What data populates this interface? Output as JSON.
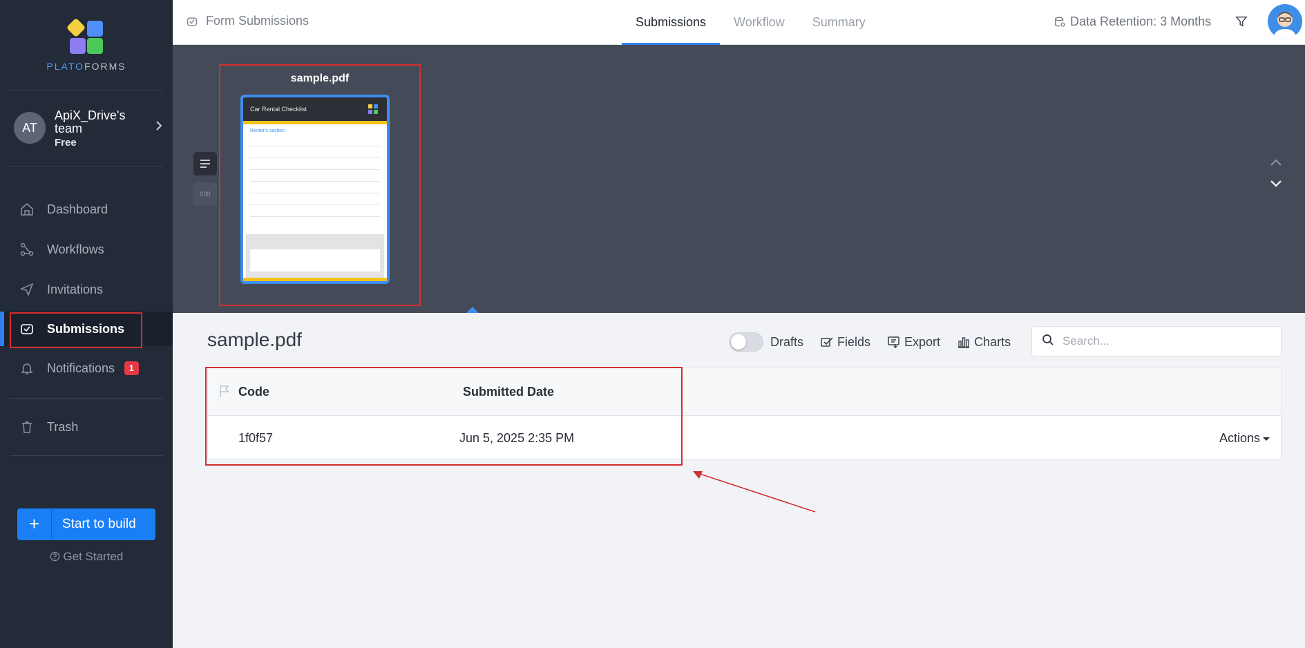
{
  "sidebar": {
    "logo": {
      "prefix": "PLATO",
      "suffix": "FORMS"
    },
    "team": {
      "initials": "AT",
      "name": "ApiX_Drive's team",
      "plan": "Free"
    },
    "nav": [
      {
        "label": "Dashboard",
        "icon": "home-icon"
      },
      {
        "label": "Workflows",
        "icon": "workflow-icon"
      },
      {
        "label": "Invitations",
        "icon": "send-icon"
      },
      {
        "label": "Submissions",
        "icon": "inbox-icon",
        "active": true
      },
      {
        "label": "Notifications",
        "icon": "bell-icon",
        "badge": "1"
      },
      {
        "label": "Trash",
        "icon": "trash-icon"
      }
    ],
    "build_button": "Start to build",
    "get_started": "Get Started"
  },
  "header": {
    "breadcrumb": "Form Submissions",
    "tabs": [
      {
        "label": "Submissions",
        "active": true
      },
      {
        "label": "Workflow"
      },
      {
        "label": "Summary"
      }
    ],
    "retention": "Data Retention: 3 Months"
  },
  "preview": {
    "file_name": "sample.pdf",
    "thumbnail": {
      "title": "Car Rental Checklist",
      "section": "Renter's section"
    }
  },
  "content": {
    "title": "sample.pdf",
    "toolbar": {
      "drafts": "Drafts",
      "fields": "Fields",
      "export": "Export",
      "charts": "Charts"
    },
    "search": {
      "placeholder": "Search..."
    },
    "table": {
      "columns": [
        "Code",
        "Submitted Date"
      ],
      "rows": [
        {
          "code": "1f0f57",
          "date": "Jun 5, 2025 2:35 PM",
          "actions": "Actions"
        }
      ]
    }
  },
  "colors": {
    "accent": "#2f7ff0",
    "sidebar": "#232a38",
    "highlight": "#d42f2f",
    "badge": "#e53945"
  }
}
